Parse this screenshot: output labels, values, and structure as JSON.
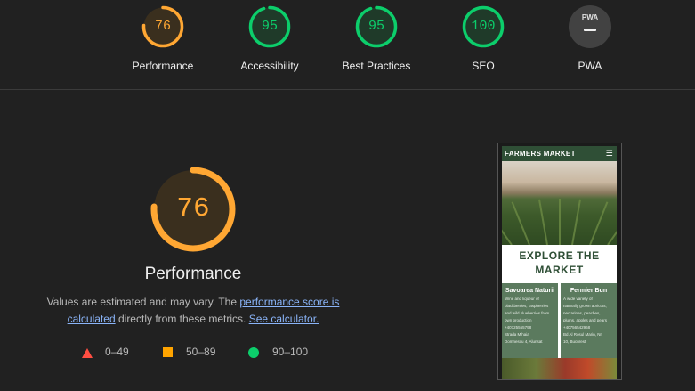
{
  "summary": [
    {
      "label": "Performance",
      "score": "76",
      "value": 76,
      "color": "#ffa733",
      "bg": "#3a2f1e"
    },
    {
      "label": "Accessibility",
      "score": "95",
      "value": 95,
      "color": "#0cce6b",
      "bg": "#1f3a29"
    },
    {
      "label": "Best Practices",
      "score": "95",
      "value": 95,
      "color": "#0cce6b",
      "bg": "#1f3a29"
    },
    {
      "label": "SEO",
      "score": "100",
      "value": 100,
      "color": "#0cce6b",
      "bg": "#1f3a29"
    },
    {
      "label": "PWA",
      "badge": "PWA"
    }
  ],
  "main": {
    "score": "76",
    "value": 76,
    "title": "Performance",
    "desc_prefix": "Values are estimated and may vary. The ",
    "link_score": "performance score is calculated",
    "desc_middle": " directly from these metrics. ",
    "link_calc": "See calculator."
  },
  "legend": {
    "fail": "0–49",
    "average": "50–89",
    "pass": "90–100",
    "colors": {
      "fail": "#ff4e42",
      "average": "#ffa400",
      "pass": "#0cce6b"
    }
  },
  "screenshot": {
    "header": "FARMERS MARKET",
    "menu_icon": "hamburger-icon",
    "headline": "EXPLORE THE MARKET",
    "cards": [
      {
        "title": "Savoarea Naturii",
        "lines": [
          "Wine and liqueur of blackberries, raspberries",
          "and wild blueberries from",
          "own production",
          "+40725555798",
          "Strada Mihaia",
          "Domnescu 4, Alunsat"
        ]
      },
      {
        "title": "Fermier Bun",
        "lines": [
          "A wide variety of",
          "naturally grown apricots,",
          "nectarines, peaches,",
          "plums, apples and pears",
          "+40756542968",
          "Bd Al Rosul Marin, Nr",
          "10, Bucuresti"
        ]
      }
    ]
  }
}
